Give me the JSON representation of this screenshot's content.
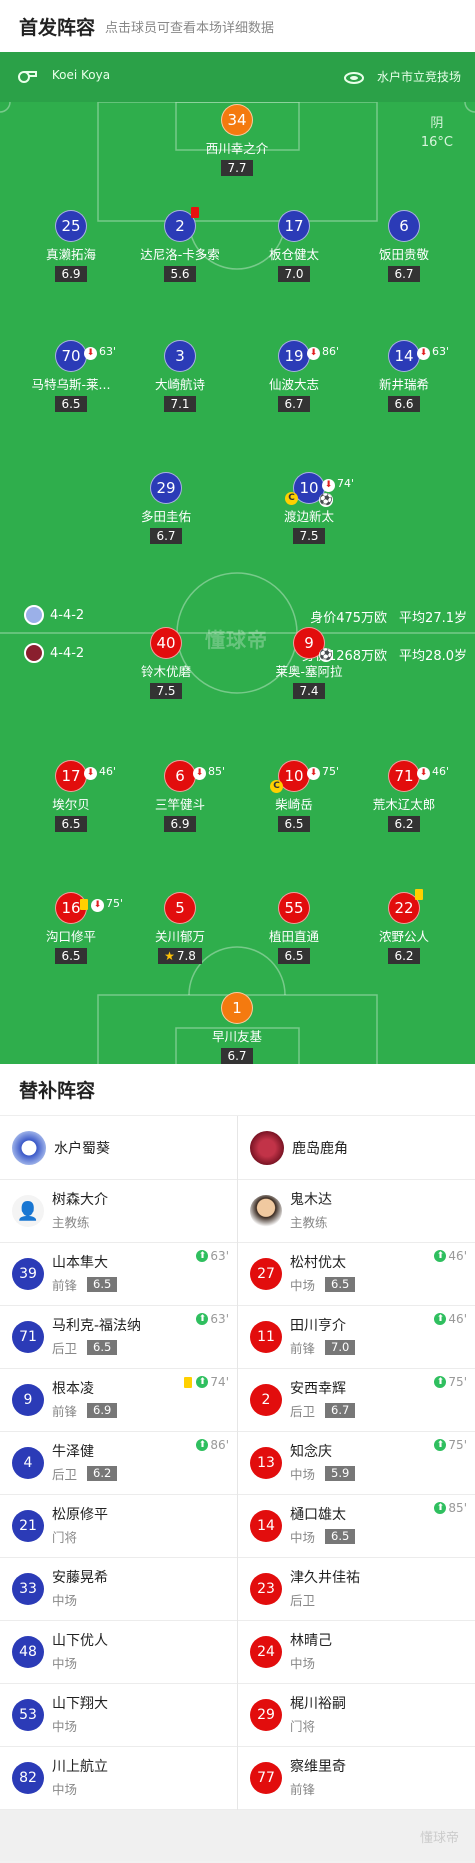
{
  "header": {
    "title": "首发阵容",
    "hint": "点击球员可查看本场详细数据"
  },
  "pitch": {
    "referee": "Koei Koya",
    "venue": "水户市立竞技场",
    "weather": "阴",
    "temperature": "16°C",
    "watermark": "懂球帝",
    "home_formation": "4-4-2",
    "home_value": "身价475万欧",
    "home_age": "平均27.1岁",
    "away_formation": "4-4-2",
    "away_value": "身价1268万欧",
    "away_age": "平均28.0岁"
  },
  "home_players": [
    {
      "num": "34",
      "name": "西川幸之介",
      "rating": "7.7"
    },
    {
      "num": "25",
      "name": "真濑拓海",
      "rating": "6.9"
    },
    {
      "num": "2",
      "name": "达尼洛-卡多索",
      "rating": "5.6"
    },
    {
      "num": "17",
      "name": "板仓健太",
      "rating": "7.0"
    },
    {
      "num": "6",
      "name": "饭田贵敬",
      "rating": "6.7"
    },
    {
      "num": "70",
      "name": "马特乌斯-莱...",
      "rating": "6.5",
      "sub": "63'"
    },
    {
      "num": "3",
      "name": "大崎航诗",
      "rating": "7.1"
    },
    {
      "num": "19",
      "name": "仙波大志",
      "rating": "6.7",
      "sub": "86'"
    },
    {
      "num": "14",
      "name": "新井瑞希",
      "rating": "6.6",
      "sub": "63'"
    },
    {
      "num": "29",
      "name": "多田圭佑",
      "rating": "6.7"
    },
    {
      "num": "10",
      "name": "渡边新太",
      "rating": "7.5",
      "sub": "74'"
    }
  ],
  "away_players": [
    {
      "num": "40",
      "name": "铃木优磨",
      "rating": "7.5"
    },
    {
      "num": "9",
      "name": "莱奥-塞阿拉",
      "rating": "7.4"
    },
    {
      "num": "17",
      "name": "埃尔贝",
      "rating": "6.5",
      "sub": "46'"
    },
    {
      "num": "6",
      "name": "三竿健斗",
      "rating": "6.9",
      "sub": "85'"
    },
    {
      "num": "10",
      "name": "柴崎岳",
      "rating": "6.5",
      "sub": "75'"
    },
    {
      "num": "71",
      "name": "荒木辽太郎",
      "rating": "6.2",
      "sub": "46'"
    },
    {
      "num": "16",
      "name": "沟口修平",
      "rating": "6.5",
      "sub": "75'"
    },
    {
      "num": "5",
      "name": "关川郁万",
      "rating": "7.8"
    },
    {
      "num": "55",
      "name": "植田直通",
      "rating": "6.5"
    },
    {
      "num": "22",
      "name": "浓野公人",
      "rating": "6.2"
    },
    {
      "num": "1",
      "name": "早川友基",
      "rating": "6.7"
    }
  ],
  "subs": {
    "title": "替补阵容",
    "home_team": "水户蜀葵",
    "away_team": "鹿岛鹿角",
    "home_coach": {
      "name": "树森大介",
      "role": "主教练"
    },
    "away_coach": {
      "name": "鬼木达",
      "role": "主教练"
    },
    "home": [
      {
        "num": "39",
        "name": "山本隼大",
        "pos": "前锋",
        "rating": "6.5",
        "sub": "63'"
      },
      {
        "num": "71",
        "name": "马利克-福法纳",
        "pos": "后卫",
        "rating": "6.5",
        "sub": "63'"
      },
      {
        "num": "9",
        "name": "根本凌",
        "pos": "前锋",
        "rating": "6.9",
        "sub": "74'"
      },
      {
        "num": "4",
        "name": "牛泽健",
        "pos": "后卫",
        "rating": "6.2",
        "sub": "86'"
      },
      {
        "num": "21",
        "name": "松原修平",
        "pos": "门将"
      },
      {
        "num": "33",
        "name": "安藤晃希",
        "pos": "中场"
      },
      {
        "num": "48",
        "name": "山下优人",
        "pos": "中场"
      },
      {
        "num": "53",
        "name": "山下翔大",
        "pos": "中场"
      },
      {
        "num": "82",
        "name": "川上航立",
        "pos": "中场"
      }
    ],
    "away": [
      {
        "num": "27",
        "name": "松村优太",
        "pos": "中场",
        "rating": "6.5",
        "sub": "46'"
      },
      {
        "num": "11",
        "name": "田川亨介",
        "pos": "前锋",
        "rating": "7.0",
        "sub": "46'"
      },
      {
        "num": "2",
        "name": "安西幸辉",
        "pos": "后卫",
        "rating": "6.7",
        "sub": "75'"
      },
      {
        "num": "13",
        "name": "知念庆",
        "pos": "中场",
        "rating": "5.9",
        "sub": "75'"
      },
      {
        "num": "14",
        "name": "樋口雄太",
        "pos": "中场",
        "rating": "6.5",
        "sub": "85'"
      },
      {
        "num": "23",
        "name": "津久井佳祐",
        "pos": "后卫"
      },
      {
        "num": "24",
        "name": "林晴己",
        "pos": "中场"
      },
      {
        "num": "29",
        "name": "梶川裕嗣",
        "pos": "门将"
      },
      {
        "num": "77",
        "name": "察维里奇",
        "pos": "前锋"
      }
    ]
  },
  "footer": {
    "watermark": "懂球帝"
  },
  "colors": {
    "pitch": "#2fae4c",
    "home": "#2b3bb7",
    "away": "#e20d0d",
    "gk": "#f47a0f"
  }
}
